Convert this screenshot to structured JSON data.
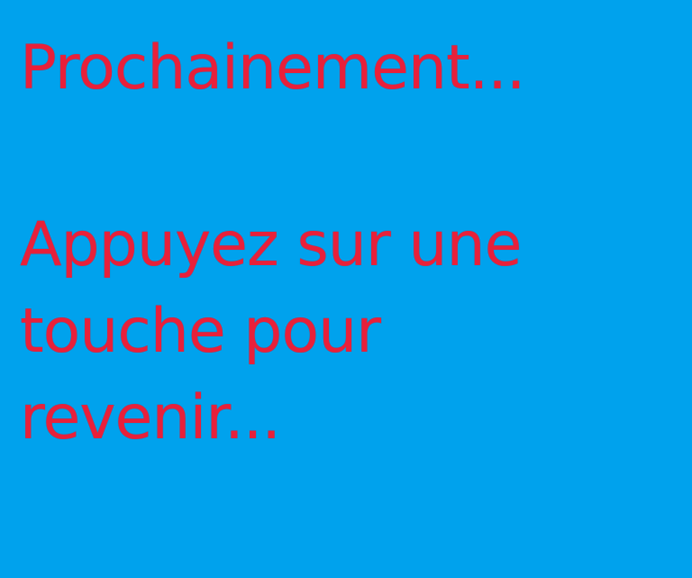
{
  "screen": {
    "title": "Prochainement...",
    "prompt_lines": [
      "Appuyez sur une",
      "touche pour",
      "revenir..."
    ]
  },
  "colors": {
    "background": "#00a2ed",
    "text": "#e8203a"
  }
}
